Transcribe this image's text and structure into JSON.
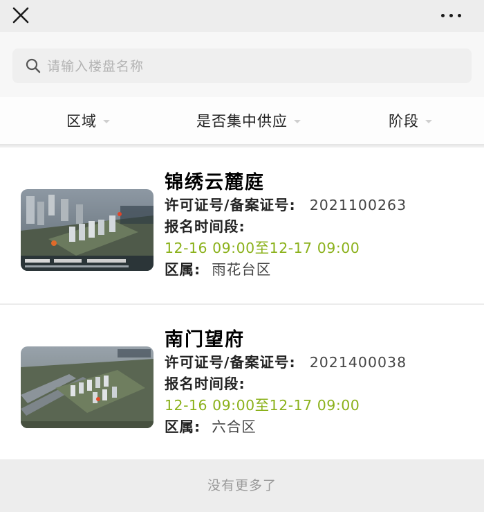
{
  "search": {
    "placeholder": "请输入楼盘名称"
  },
  "filters": [
    {
      "label": "区域"
    },
    {
      "label": "是否集中供应"
    },
    {
      "label": "阶段"
    }
  ],
  "field_labels": {
    "license": "许可证号/备案证号:",
    "signup_period": "报名时间段:",
    "district": "区属:"
  },
  "projects": [
    {
      "name": "锦绣云麓庭",
      "license_no": "2021100263",
      "signup_time": "12-16 09:00至12-17 09:00",
      "district": "雨花台区"
    },
    {
      "name": "南门望府",
      "license_no": "2021400038",
      "signup_time": "12-16 09:00至12-17 09:00",
      "district": "六合区"
    }
  ],
  "footer": {
    "text": "没有更多了"
  },
  "colors": {
    "accent_time": "#8bb11b",
    "background": "#ededed"
  },
  "icons": {
    "close": "close-icon",
    "more": "more-icon",
    "search": "search-icon"
  }
}
